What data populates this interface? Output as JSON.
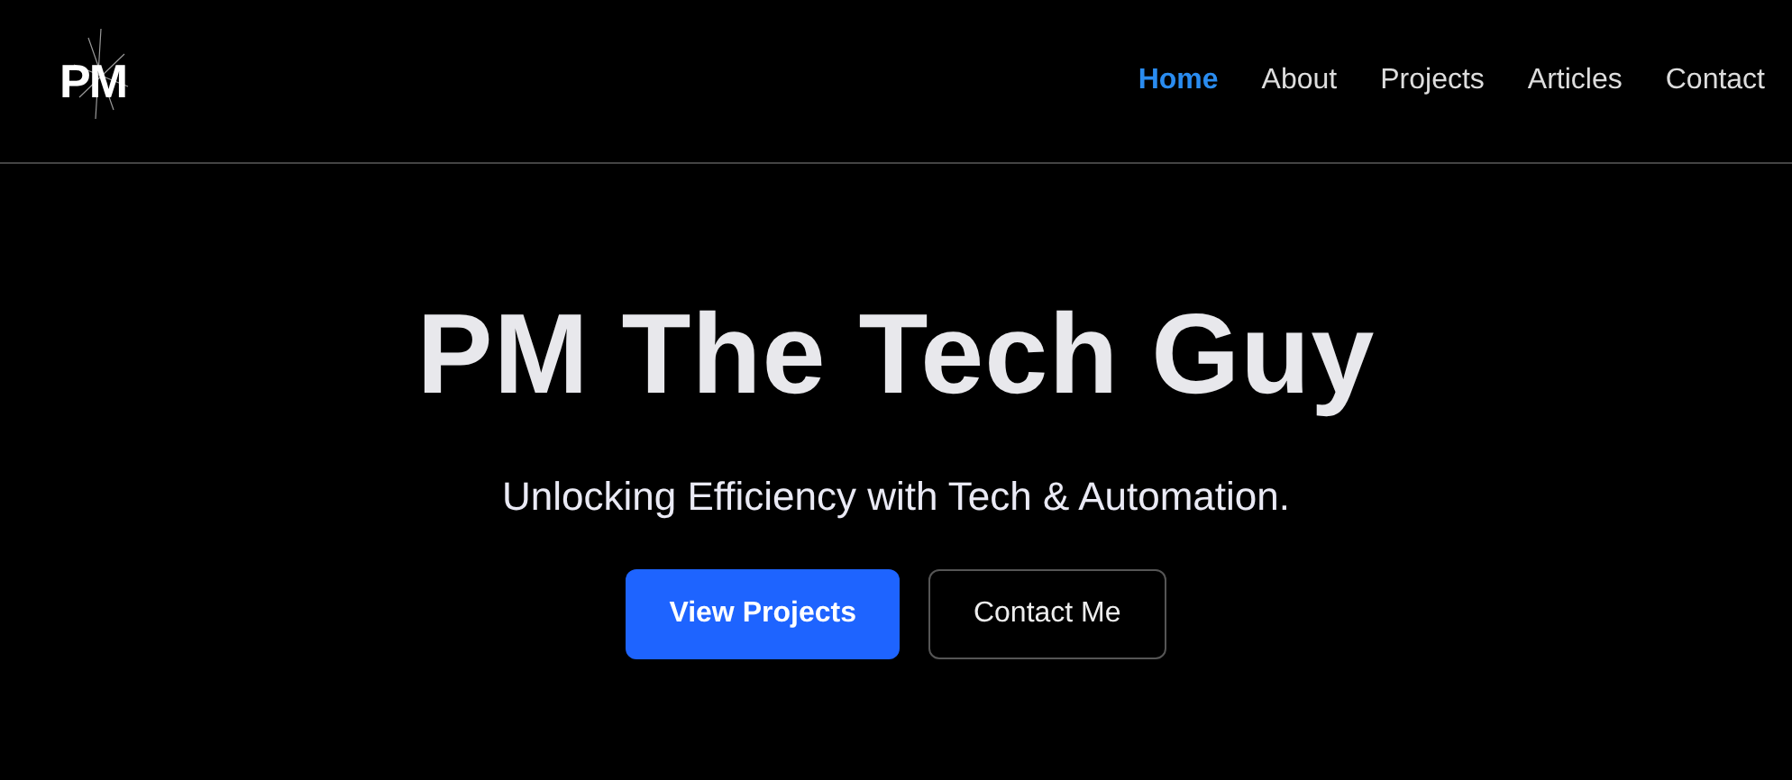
{
  "header": {
    "logo": "PM",
    "nav": [
      {
        "label": "Home",
        "selected": true
      },
      {
        "label": "About",
        "selected": false
      },
      {
        "label": "Projects",
        "selected": false
      },
      {
        "label": "Articles",
        "selected": false
      },
      {
        "label": "Contact",
        "selected": false
      }
    ]
  },
  "hero": {
    "title": "PM The Tech Guy",
    "subtitle": "Unlocking Efficiency with Tech & Automation.",
    "buttons": [
      {
        "label": "View Projects",
        "kind": "primary"
      },
      {
        "label": "Contact Me",
        "kind": "outline"
      }
    ]
  }
}
